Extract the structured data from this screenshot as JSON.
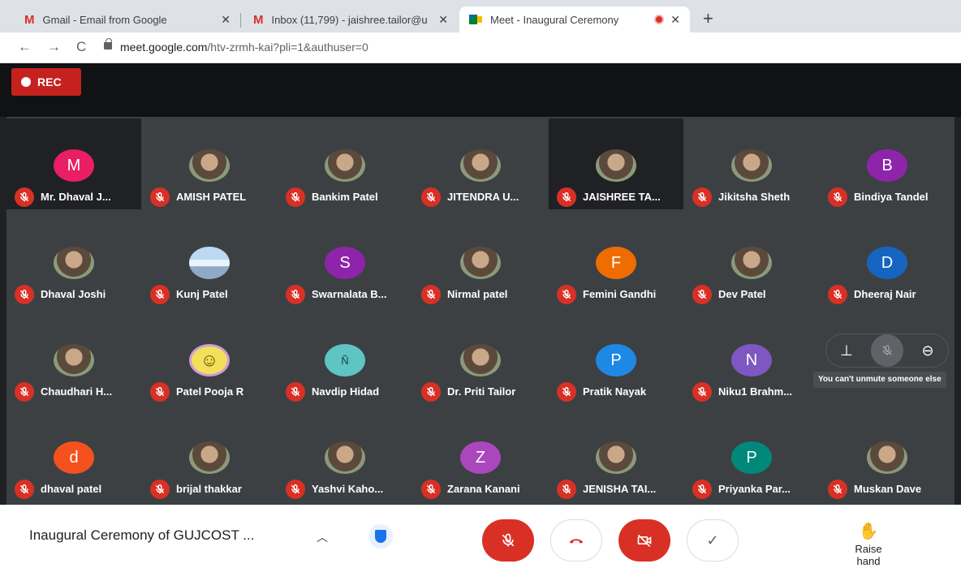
{
  "browser": {
    "tabs": [
      {
        "title": "Gmail - Email from Google",
        "icon": "gmail-icon"
      },
      {
        "title": "Inbox (11,799) - jaishree.tailor@u",
        "icon": "gmail-icon"
      },
      {
        "title": "Meet - Inaugural Ceremony",
        "icon": "meet-icon",
        "active": true,
        "recording": true
      }
    ],
    "url_host": "meet.google.com",
    "url_path": "/htv-zrmh-kai?pli=1&authuser=0"
  },
  "rec_label": "REC",
  "participants": [
    {
      "name": "Mr. Dhaval J...",
      "avatar": "M",
      "avatar_color": "#e91e63"
    },
    {
      "name": "AMISH PATEL",
      "avatar": "photo"
    },
    {
      "name": "Bankim Patel",
      "avatar": "photo"
    },
    {
      "name": "JITENDRA U...",
      "avatar": "photo"
    },
    {
      "name": "JAISHREE TA...",
      "avatar": "photo"
    },
    {
      "name": "Jikitsha Sheth",
      "avatar": "photo"
    },
    {
      "name": "Bindiya Tandel",
      "avatar": "B",
      "avatar_color": "#8e24aa"
    },
    {
      "name": "Dhaval Joshi",
      "avatar": "photo"
    },
    {
      "name": "Kunj Patel",
      "avatar": "photo"
    },
    {
      "name": "Swarnalata B...",
      "avatar": "S",
      "avatar_color": "#8e24aa"
    },
    {
      "name": "Nirmal patel",
      "avatar": "photo"
    },
    {
      "name": "Femini Gandhi",
      "avatar": "F",
      "avatar_color": "#ef6c00"
    },
    {
      "name": "Dev Patel",
      "avatar": "photo"
    },
    {
      "name": "Dheeraj Nair",
      "avatar": "D",
      "avatar_color": "#1565c0"
    },
    {
      "name": "Chaudhari H...",
      "avatar": "photo"
    },
    {
      "name": "Patel Pooja R",
      "avatar": "photo"
    },
    {
      "name": "Navdip Hidad",
      "avatar": "photo"
    },
    {
      "name": "Dr. Priti Tailor",
      "avatar": "photo"
    },
    {
      "name": "Pratik Nayak",
      "avatar": "P",
      "avatar_color": "#1e88e5"
    },
    {
      "name": "Niku1 Brahm...",
      "avatar": "N",
      "avatar_color": "#7e57c2"
    },
    {
      "name": "",
      "avatar": "hover"
    },
    {
      "name": "dhaval patel",
      "avatar": "d",
      "avatar_color": "#f4511e"
    },
    {
      "name": "brijal thakkar",
      "avatar": "photo"
    },
    {
      "name": "Yashvi Kaho...",
      "avatar": "photo"
    },
    {
      "name": "Zarana Kanani",
      "avatar": "Z",
      "avatar_color": "#ab47bc"
    },
    {
      "name": "JENISHA TAI...",
      "avatar": "photo"
    },
    {
      "name": "Priyanka Par...",
      "avatar": "P",
      "avatar_color": "#00897b"
    },
    {
      "name": "Muskan Dave",
      "avatar": "photo"
    }
  ],
  "tooltip": "You can't unmute someone else",
  "meeting_title": "Inaugural Ceremony of GUJCOST ...",
  "raise_hand_label": "Raise hand",
  "colors": {
    "accent_red": "#d93025",
    "meet_bg": "#202124",
    "tile_bg": "#3c4043"
  }
}
